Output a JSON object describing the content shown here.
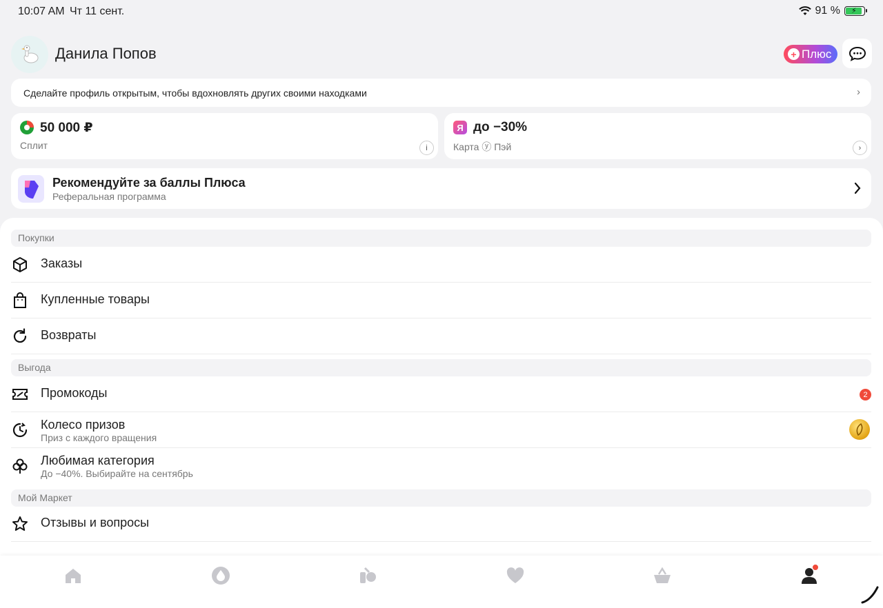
{
  "status_bar": {
    "time": "10:07 AM",
    "date": "Чт 11 сент.",
    "battery": "91 %"
  },
  "header": {
    "user_name": "Данила Попов",
    "plus_label": "Плюс"
  },
  "banner": {
    "text": "Сделайте профиль открытым, чтобы вдохновлять других своими находками"
  },
  "cards": {
    "split": {
      "value": "50 000 ₽",
      "label": "Сплит"
    },
    "pay": {
      "value": "до −30%",
      "label": "Карта ⓨ Пэй"
    }
  },
  "referral": {
    "title": "Рекомендуйте за баллы Плюса",
    "subtitle": "Реферальная программа"
  },
  "sections": {
    "purchases": "Покупки",
    "benefit": "Выгода",
    "my_market": "Мой Маркет"
  },
  "menu": {
    "orders": "Заказы",
    "purchased": "Купленные товары",
    "returns": "Возвраты",
    "promocodes": "Промокоды",
    "promocodes_count": "2",
    "wheel": "Колесо призов",
    "wheel_sub": "Приз с каждого вращения",
    "fav_category": "Любимая категория",
    "fav_category_sub": "До −40%. Выбирайте на сентябрь",
    "reviews": "Отзывы и вопросы"
  },
  "tabbar": [
    "home-icon",
    "plus-drop-icon",
    "catalog-icon",
    "heart-icon",
    "cart-icon",
    "profile-icon"
  ],
  "colors": {
    "accent_red": "#f04a3a",
    "plus_gradient_start": "#ff4b5c",
    "plus_gradient_end": "#5b6dfa"
  }
}
